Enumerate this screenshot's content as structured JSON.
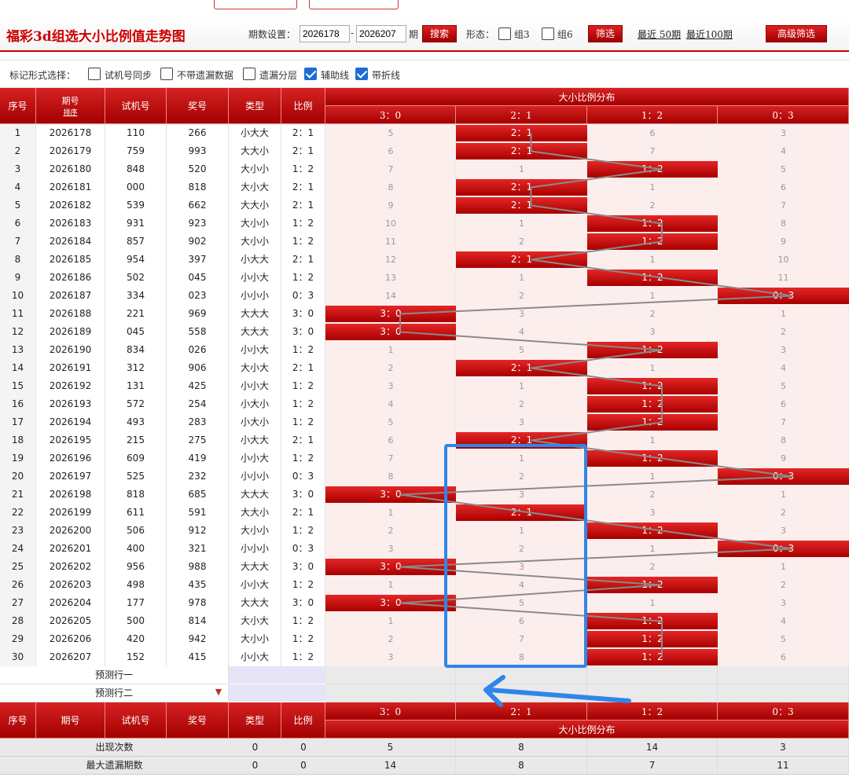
{
  "page": {
    "title": "福彩3d组选大小比例值走势图",
    "period_label": "期数设置：",
    "period_start": "2026178",
    "period_sep": "-",
    "period_end": "2026207",
    "period_unit": "期",
    "search_btn": "搜索",
    "shape_label": "形态：",
    "shape_opts": [
      "组3",
      "组6"
    ],
    "filter_btn": "筛选",
    "recent_50": "最近 50期",
    "recent_100": "最近100期",
    "advanced_btn": "高级筛选"
  },
  "options": {
    "label": "标记形式选择：",
    "items": [
      {
        "label": "试机号同步",
        "checked": false
      },
      {
        "label": "不带遗漏数据",
        "checked": false
      },
      {
        "label": "遗漏分层",
        "checked": false
      },
      {
        "label": "辅助线",
        "checked": true
      },
      {
        "label": "带折线",
        "checked": true
      }
    ]
  },
  "headers": {
    "seq": "序号",
    "period": "期号",
    "sort": "排序",
    "trial": "试机号",
    "draw": "奖号",
    "type": "类型",
    "ratio": "比例",
    "dist": "大小比例分布",
    "dist_cols": [
      "3：0",
      "2：1",
      "1：2",
      "0：3"
    ]
  },
  "rows": [
    {
      "seq": "1",
      "period": "2026178",
      "trial": "110",
      "draw": "266",
      "type": "小大大",
      "ratio": "2：1",
      "hit": 1,
      "cells": [
        "5",
        "2：1",
        "6",
        "3"
      ]
    },
    {
      "seq": "2",
      "period": "2026179",
      "trial": "759",
      "draw": "993",
      "type": "大大小",
      "ratio": "2：1",
      "hit": 1,
      "cells": [
        "6",
        "2：1",
        "7",
        "4"
      ]
    },
    {
      "seq": "3",
      "period": "2026180",
      "trial": "848",
      "draw": "520",
      "type": "大小小",
      "ratio": "1：2",
      "hit": 2,
      "cells": [
        "7",
        "1",
        "1：2",
        "5"
      ]
    },
    {
      "seq": "4",
      "period": "2026181",
      "trial": "000",
      "draw": "818",
      "type": "大小大",
      "ratio": "2：1",
      "hit": 1,
      "cells": [
        "8",
        "2：1",
        "1",
        "6"
      ]
    },
    {
      "seq": "5",
      "period": "2026182",
      "trial": "539",
      "draw": "662",
      "type": "大大小",
      "ratio": "2：1",
      "hit": 1,
      "cells": [
        "9",
        "2：1",
        "2",
        "7"
      ]
    },
    {
      "seq": "6",
      "period": "2026183",
      "trial": "931",
      "draw": "923",
      "type": "大小小",
      "ratio": "1：2",
      "hit": 2,
      "cells": [
        "10",
        "1",
        "1：2",
        "8"
      ]
    },
    {
      "seq": "7",
      "period": "2026184",
      "trial": "857",
      "draw": "902",
      "type": "大小小",
      "ratio": "1：2",
      "hit": 2,
      "cells": [
        "11",
        "2",
        "1：2",
        "9"
      ]
    },
    {
      "seq": "8",
      "period": "2026185",
      "trial": "954",
      "draw": "397",
      "type": "小大大",
      "ratio": "2：1",
      "hit": 1,
      "cells": [
        "12",
        "2：1",
        "1",
        "10"
      ]
    },
    {
      "seq": "9",
      "period": "2026186",
      "trial": "502",
      "draw": "045",
      "type": "小小大",
      "ratio": "1：2",
      "hit": 2,
      "cells": [
        "13",
        "1",
        "1：2",
        "11"
      ]
    },
    {
      "seq": "10",
      "period": "2026187",
      "trial": "334",
      "draw": "023",
      "type": "小小小",
      "ratio": "0：3",
      "hit": 3,
      "cells": [
        "14",
        "2",
        "1",
        "0：3"
      ]
    },
    {
      "seq": "11",
      "period": "2026188",
      "trial": "221",
      "draw": "969",
      "type": "大大大",
      "ratio": "3：0",
      "hit": 0,
      "cells": [
        "3：0",
        "3",
        "2",
        "1"
      ]
    },
    {
      "seq": "12",
      "period": "2026189",
      "trial": "045",
      "draw": "558",
      "type": "大大大",
      "ratio": "3：0",
      "hit": 0,
      "cells": [
        "3：0",
        "4",
        "3",
        "2"
      ]
    },
    {
      "seq": "13",
      "period": "2026190",
      "trial": "834",
      "draw": "026",
      "type": "小小大",
      "ratio": "1：2",
      "hit": 2,
      "cells": [
        "1",
        "5",
        "1：2",
        "3"
      ]
    },
    {
      "seq": "14",
      "period": "2026191",
      "trial": "312",
      "draw": "906",
      "type": "大小大",
      "ratio": "2：1",
      "hit": 1,
      "cells": [
        "2",
        "2：1",
        "1",
        "4"
      ]
    },
    {
      "seq": "15",
      "period": "2026192",
      "trial": "131",
      "draw": "425",
      "type": "小小大",
      "ratio": "1：2",
      "hit": 2,
      "cells": [
        "3",
        "1",
        "1：2",
        "5"
      ]
    },
    {
      "seq": "16",
      "period": "2026193",
      "trial": "572",
      "draw": "254",
      "type": "小大小",
      "ratio": "1：2",
      "hit": 2,
      "cells": [
        "4",
        "2",
        "1：2",
        "6"
      ]
    },
    {
      "seq": "17",
      "period": "2026194",
      "trial": "493",
      "draw": "283",
      "type": "小大小",
      "ratio": "1：2",
      "hit": 2,
      "cells": [
        "5",
        "3",
        "1：2",
        "7"
      ]
    },
    {
      "seq": "18",
      "period": "2026195",
      "trial": "215",
      "draw": "275",
      "type": "小大大",
      "ratio": "2：1",
      "hit": 1,
      "cells": [
        "6",
        "2：1",
        "1",
        "8"
      ]
    },
    {
      "seq": "19",
      "period": "2026196",
      "trial": "609",
      "draw": "419",
      "type": "小小大",
      "ratio": "1：2",
      "hit": 2,
      "cells": [
        "7",
        "1",
        "1：2",
        "9"
      ]
    },
    {
      "seq": "20",
      "period": "2026197",
      "trial": "525",
      "draw": "232",
      "type": "小小小",
      "ratio": "0：3",
      "hit": 3,
      "cells": [
        "8",
        "2",
        "1",
        "0：3"
      ]
    },
    {
      "seq": "21",
      "period": "2026198",
      "trial": "818",
      "draw": "685",
      "type": "大大大",
      "ratio": "3：0",
      "hit": 0,
      "cells": [
        "3：0",
        "3",
        "2",
        "1"
      ]
    },
    {
      "seq": "22",
      "period": "2026199",
      "trial": "611",
      "draw": "591",
      "type": "大大小",
      "ratio": "2：1",
      "hit": 1,
      "cells": [
        "1",
        "2：1",
        "3",
        "2"
      ]
    },
    {
      "seq": "23",
      "period": "2026200",
      "trial": "506",
      "draw": "912",
      "type": "大小小",
      "ratio": "1：2",
      "hit": 2,
      "cells": [
        "2",
        "1",
        "1：2",
        "3"
      ]
    },
    {
      "seq": "24",
      "period": "2026201",
      "trial": "400",
      "draw": "321",
      "type": "小小小",
      "ratio": "0：3",
      "hit": 3,
      "cells": [
        "3",
        "2",
        "1",
        "0：3"
      ]
    },
    {
      "seq": "25",
      "period": "2026202",
      "trial": "956",
      "draw": "988",
      "type": "大大大",
      "ratio": "3：0",
      "hit": 0,
      "cells": [
        "3：0",
        "3",
        "2",
        "1"
      ]
    },
    {
      "seq": "26",
      "period": "2026203",
      "trial": "498",
      "draw": "435",
      "type": "小小大",
      "ratio": "1：2",
      "hit": 2,
      "cells": [
        "1",
        "4",
        "1：2",
        "2"
      ]
    },
    {
      "seq": "27",
      "period": "2026204",
      "trial": "177",
      "draw": "978",
      "type": "大大大",
      "ratio": "3：0",
      "hit": 0,
      "cells": [
        "3：0",
        "5",
        "1",
        "3"
      ]
    },
    {
      "seq": "28",
      "period": "2026205",
      "trial": "500",
      "draw": "814",
      "type": "大小大",
      "ratio": "1：2",
      "hit": 2,
      "cells": [
        "1",
        "6",
        "1：2",
        "4"
      ]
    },
    {
      "seq": "29",
      "period": "2026206",
      "trial": "420",
      "draw": "942",
      "type": "大小小",
      "ratio": "1：2",
      "hit": 2,
      "cells": [
        "2",
        "7",
        "1：2",
        "5"
      ]
    },
    {
      "seq": "30",
      "period": "2026207",
      "trial": "152",
      "draw": "415",
      "type": "小小大",
      "ratio": "1：2",
      "hit": 2,
      "cells": [
        "3",
        "8",
        "1：2",
        "6"
      ]
    }
  ],
  "predict": [
    "预测行一",
    "预测行二"
  ],
  "stats": [
    {
      "label": "出现次数",
      "type": "0",
      "ratio": "0",
      "cells": [
        "5",
        "8",
        "14",
        "3"
      ]
    },
    {
      "label": "最大遗漏期数",
      "type": "0",
      "ratio": "0",
      "cells": [
        "14",
        "8",
        "7",
        "11"
      ]
    }
  ]
}
